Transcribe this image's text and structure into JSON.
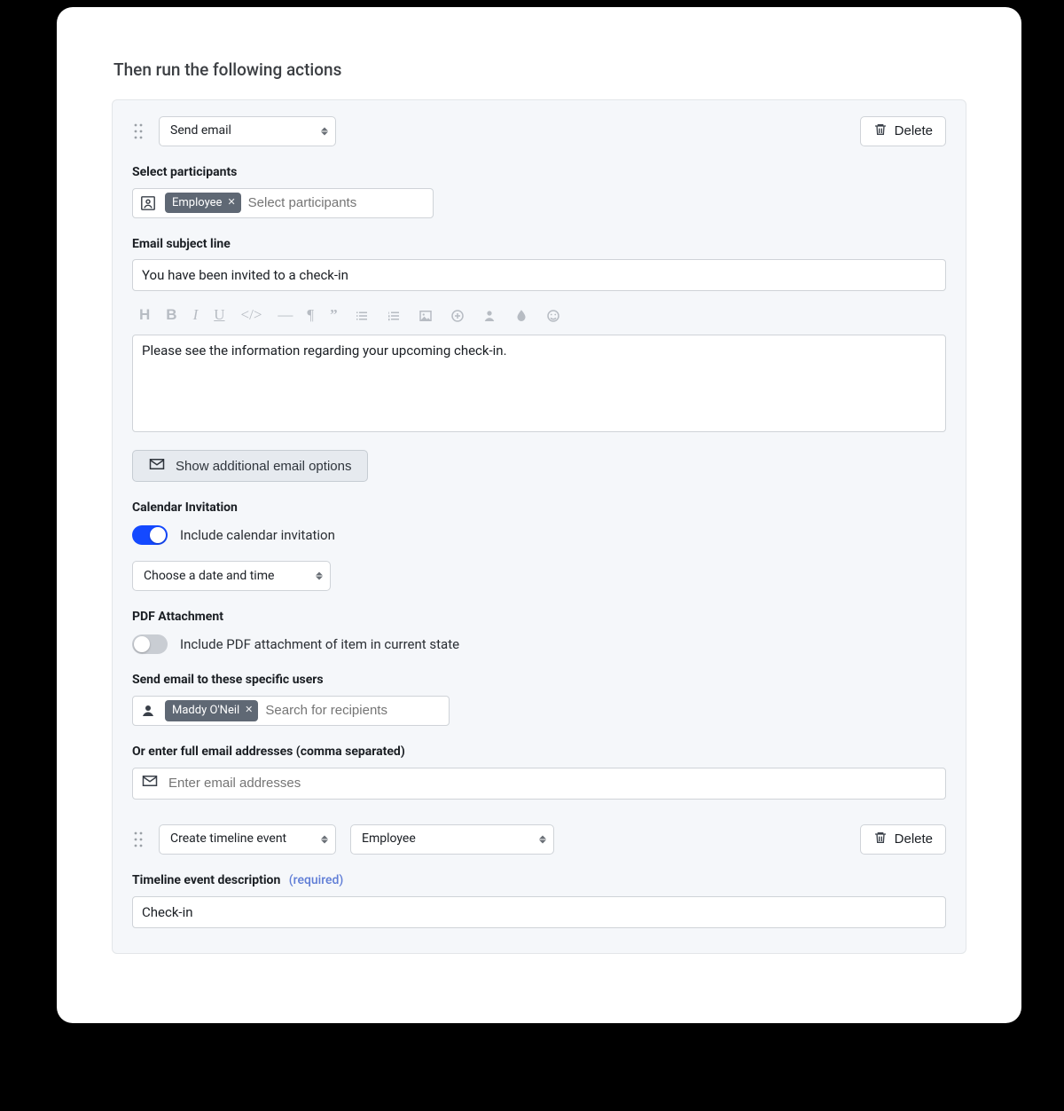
{
  "header": {
    "title": "Then run the following actions"
  },
  "action1": {
    "type_label": "Send email",
    "delete_label": "Delete",
    "participants": {
      "label": "Select participants",
      "chip": "Employee",
      "placeholder": "Select participants"
    },
    "subject": {
      "label": "Email subject line",
      "value": "You have been invited to a check-in"
    },
    "body": {
      "value": "Please see the information regarding your upcoming check-in."
    },
    "more_options_label": "Show additional email options",
    "calendar": {
      "heading": "Calendar Invitation",
      "toggle_label": "Include calendar invitation",
      "date_select": "Choose a date and time"
    },
    "pdf": {
      "heading": "PDF Attachment",
      "toggle_label": "Include PDF attachment of item in current state"
    },
    "specific_users": {
      "label": "Send email to these specific users",
      "chip": "Maddy O'Neil",
      "placeholder": "Search for recipients"
    },
    "raw_emails": {
      "label": "Or enter full email addresses (comma separated)",
      "placeholder": "Enter email addresses"
    }
  },
  "action2": {
    "type_label": "Create timeline event",
    "target_label": "Employee",
    "delete_label": "Delete",
    "desc": {
      "label": "Timeline event description",
      "required": "(required)",
      "value": "Check-in"
    }
  }
}
